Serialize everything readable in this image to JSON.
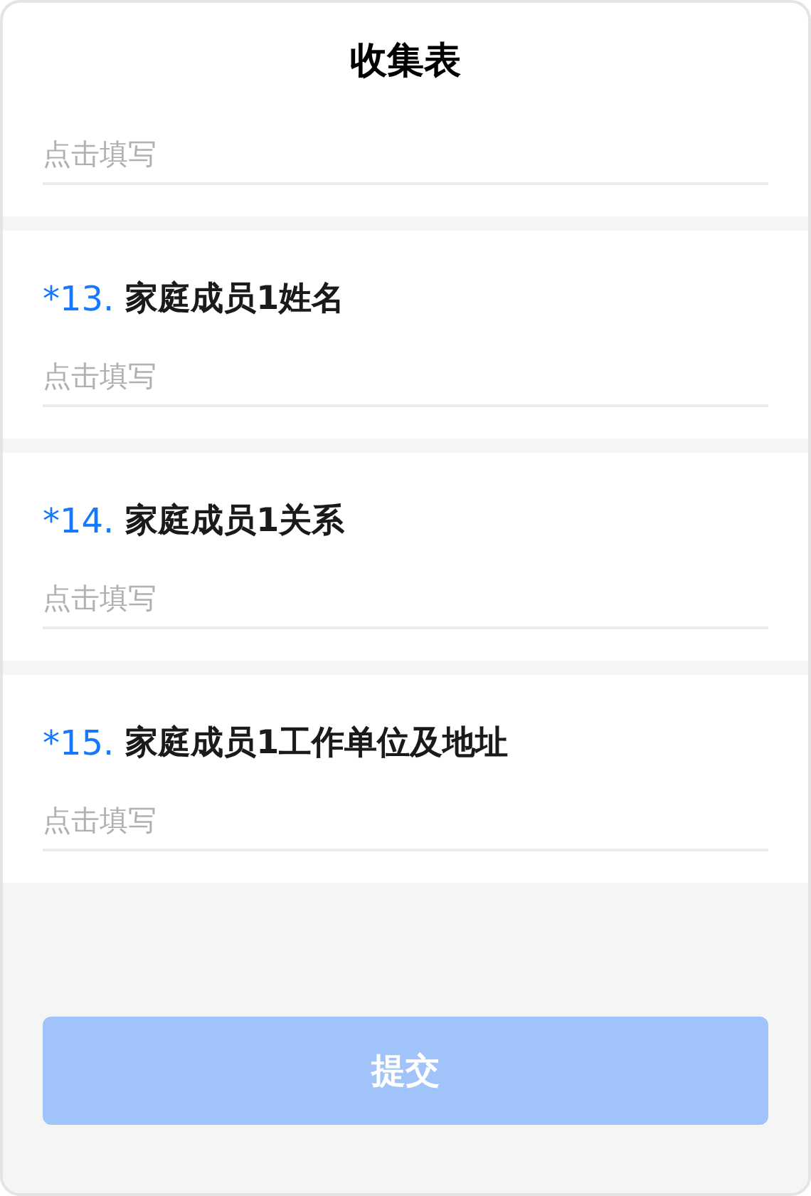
{
  "title": "收集表",
  "sections": [
    {
      "field": {
        "placeholder": "点击填写"
      }
    },
    {
      "number": "*13.",
      "question": "家庭成员1姓名",
      "field": {
        "placeholder": "点击填写"
      }
    },
    {
      "number": "*14.",
      "question": "家庭成员1关系",
      "field": {
        "placeholder": "点击填写"
      }
    },
    {
      "number": "*15.",
      "question": "家庭成员1工作单位及地址",
      "field": {
        "placeholder": "点击填写"
      }
    }
  ],
  "submit_button": {
    "label": "提交",
    "disabled": true
  }
}
